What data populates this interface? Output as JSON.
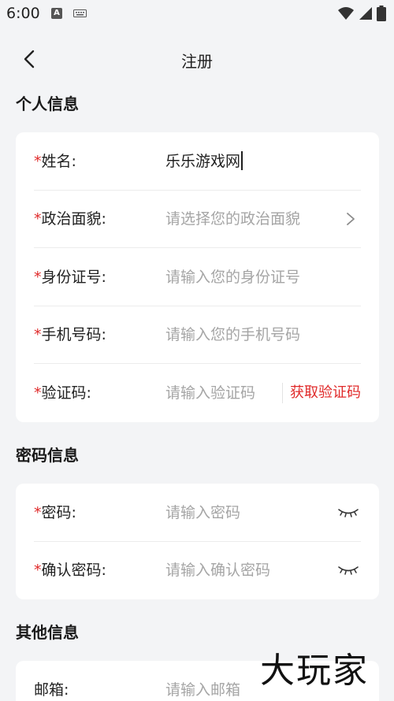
{
  "status_bar": {
    "time": "6:00",
    "left_icons": [
      "text-a-icon",
      "keyboard-icon"
    ],
    "right_icons": [
      "wifi-icon",
      "signal-icon",
      "battery-icon"
    ]
  },
  "nav": {
    "title": "注册",
    "back_icon": "chevron-left-icon"
  },
  "sections": {
    "personal": {
      "title": "个人信息",
      "name": {
        "required": "*",
        "label": "姓名:",
        "value": "乐乐游戏网"
      },
      "political": {
        "required": "*",
        "label": "政治面貌:",
        "placeholder": "请选择您的政治面貌"
      },
      "id_number": {
        "required": "*",
        "label": "身份证号:",
        "placeholder": "请输入您的身份证号"
      },
      "phone": {
        "required": "*",
        "label": "手机号码:",
        "placeholder": "请输入您的手机号码"
      },
      "code": {
        "required": "*",
        "label": "验证码:",
        "placeholder": "请输入验证码",
        "button": "获取验证码"
      }
    },
    "password": {
      "title": "密码信息",
      "password": {
        "required": "*",
        "label": "密码:",
        "placeholder": "请输入密码"
      },
      "confirm": {
        "required": "*",
        "label": "确认密码:",
        "placeholder": "请输入确认密码"
      }
    },
    "other": {
      "title": "其他信息",
      "email": {
        "label": "邮箱:",
        "placeholder": "请输入邮箱"
      }
    }
  },
  "watermark": "大玩家",
  "colors": {
    "accent_red": "#e02a2a",
    "placeholder": "#a5a5a5",
    "background": "#f3f4f6",
    "card": "#ffffff"
  }
}
